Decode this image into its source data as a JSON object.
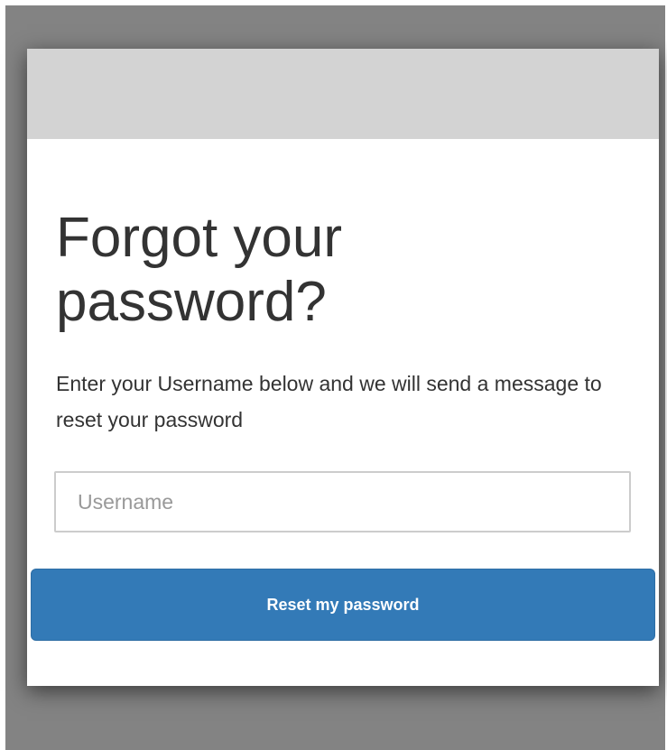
{
  "page": {
    "title_line1": "Forgot your",
    "title_line2": "password?",
    "description": "Enter your Username below and we will send a message to reset your password"
  },
  "form": {
    "username": {
      "placeholder": "Username",
      "value": ""
    },
    "submit_label": "Reset my password"
  },
  "colors": {
    "backdrop": "#838383",
    "banner": "#d3d3d3",
    "card": "#ffffff",
    "primary_button": "#337ab7",
    "text": "#333333"
  }
}
